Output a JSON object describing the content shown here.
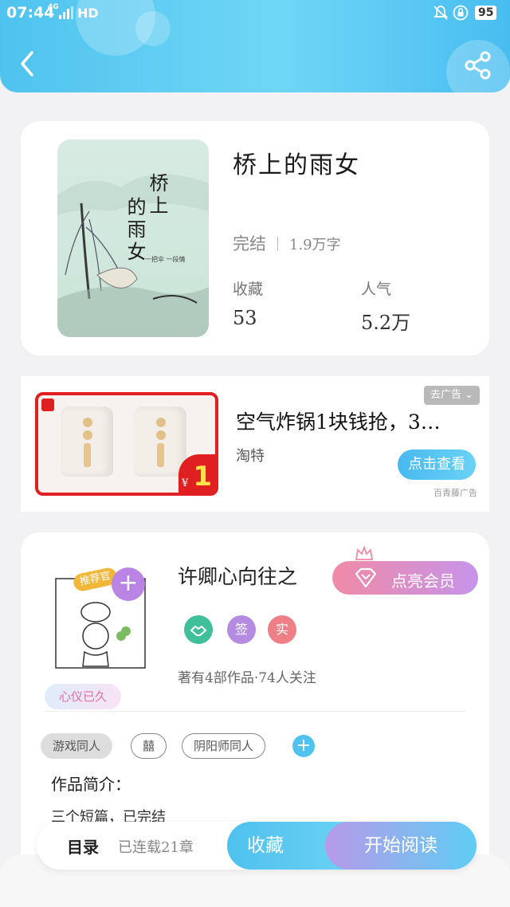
{
  "status_bar": {
    "time": "07:44",
    "network": "4G",
    "hd": "HD",
    "battery": "95"
  },
  "header": {
    "back_icon": "chevron-left-icon",
    "share_icon": "share-icon"
  },
  "book": {
    "title": "桥上的雨女",
    "cover": {
      "title_chars": [
        "桥上",
        "的雨女"
      ],
      "quote": "一把伞 一段情"
    },
    "status": "完结",
    "word_count": "1.9万字",
    "favorites_label": "收藏",
    "favorites_value": "53",
    "popularity_label": "人气",
    "popularity_value": "5.2万"
  },
  "ad": {
    "close_label": "去广告",
    "title": "空气炸锅1块钱抢，3…",
    "brand": "淘特",
    "cta": "点击查看",
    "source": "百青藤广告",
    "price": "1",
    "currency": "¥"
  },
  "author": {
    "name": "许卿心向往之",
    "vip_label": "点亮会员",
    "recommend_label": "推荐官",
    "motto": "心仪已久",
    "badges": [
      "签",
      "实"
    ],
    "follow_text": "著有4部作品·74人关注",
    "tags": [
      "游戏同人",
      "囍",
      "阴阳师同人"
    ],
    "intro_label": "作品简介：",
    "intro_text": "三个短篇，已完结"
  },
  "bottom": {
    "toc_label": "目录",
    "chapters": "已连载21章",
    "favorite_label": "收藏",
    "read_label": "开始阅读"
  },
  "colors": {
    "accent": "#4fc3ee",
    "ad_red": "#e02020",
    "vip_pink": "#f08aa6",
    "vip_purple": "#c694ea"
  }
}
